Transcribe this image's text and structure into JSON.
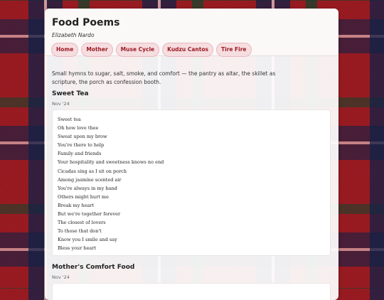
{
  "site": {
    "title": "Food Poems",
    "author": "Elizabeth Nardo"
  },
  "nav": [
    {
      "label": "Home"
    },
    {
      "label": "Mother"
    },
    {
      "label": "Muse Cycle"
    },
    {
      "label": "Kudzu Cantos"
    },
    {
      "label": "Tire Fire"
    }
  ],
  "intro": "Small hymns to sugar, salt, smoke, and comfort — the pantry as altar, the skillet as scripture, the porch as confession booth.",
  "poems": [
    {
      "title": "Sweet Tea",
      "date": "Nov '24",
      "lines": [
        "Sweet tea",
        "Oh how love thee",
        "Sweat upon my brow",
        "You're there to help",
        "Family and friends",
        "Your hospitality and sweetness knows no end",
        "Cicadas sing as I sit on porch",
        "Among jasmine scented air",
        "You're always in my hand",
        "Others might hurt me",
        "Break my heart",
        "But we're together forever",
        "The closest of lovers",
        "To those that don't",
        "Know you I smile and say",
        "Bless your heart"
      ]
    },
    {
      "title": "Mother's Comfort Food",
      "date": "Nov '24",
      "lines": []
    }
  ],
  "colors": {
    "accent": "#9b1b22",
    "pill_bg": "#f6dde0",
    "tartan_red": "#9b1b22",
    "tartan_navy": "#122046",
    "tartan_green": "#0f462d"
  }
}
